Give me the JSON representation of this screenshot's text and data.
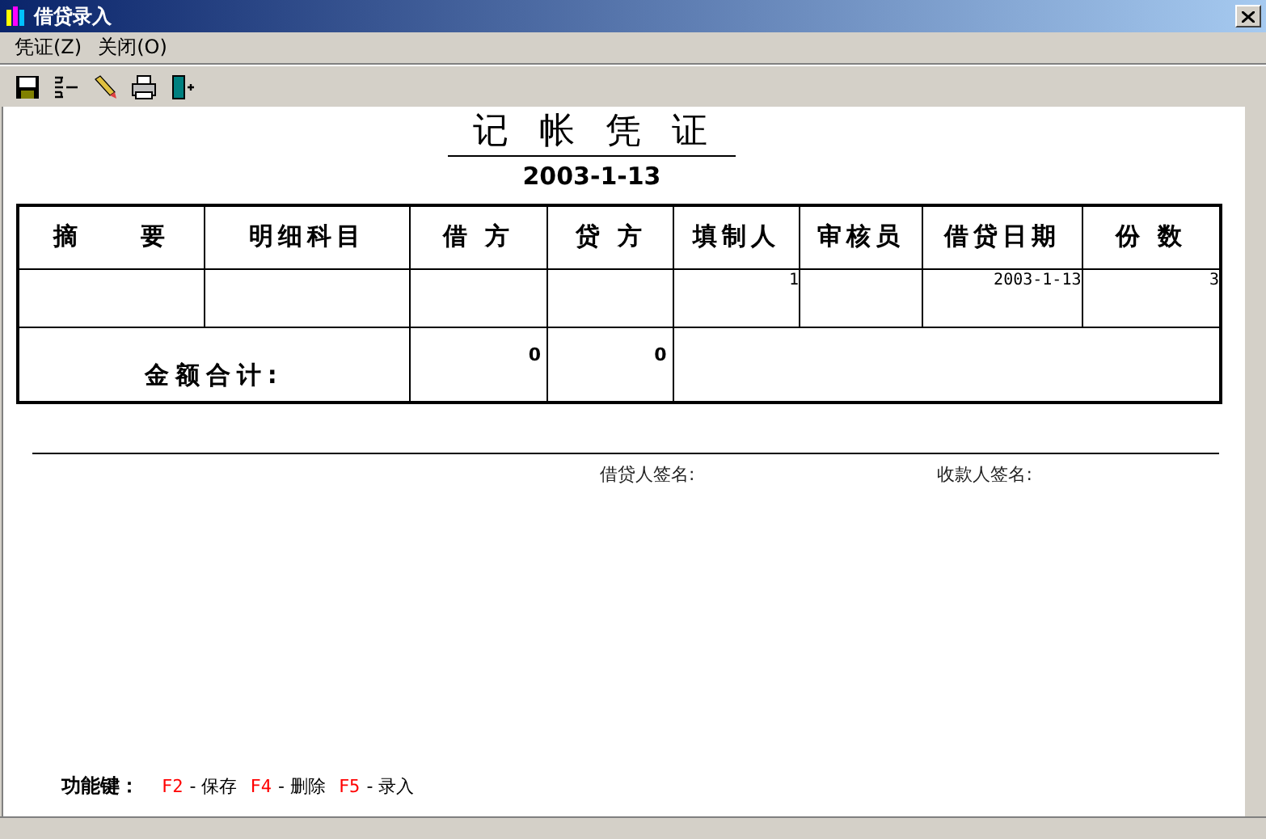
{
  "window": {
    "title": "借贷录入"
  },
  "menu": [
    "凭证(Z)",
    "关闭(O)"
  ],
  "toolbar": [
    {
      "kind": "save"
    },
    {
      "kind": "list"
    },
    {
      "kind": "edit"
    },
    {
      "kind": "print"
    },
    {
      "kind": "exit"
    }
  ],
  "voucher": {
    "title": "记 帐 凭 证",
    "date": "2003-1-13"
  },
  "table": {
    "columns": [
      "摘　　要",
      "明细科目",
      "借 方",
      "贷 方",
      "填制人",
      "审核员",
      "借贷日期",
      "份 数"
    ],
    "rows": [
      [
        "",
        "",
        "",
        "",
        "1",
        "",
        "2003-1-13",
        "3"
      ]
    ],
    "total_label": "金额合计:",
    "total_debit": "0",
    "total_credit": "0"
  },
  "signatures": [
    "借贷人签名:",
    "收款人签名:"
  ],
  "function_keys": {
    "label": "功能键：",
    "items": [
      {
        "key": "F2",
        "action": "- 保存"
      },
      {
        "key": "F4",
        "action": "- 删除"
      },
      {
        "key": "F5",
        "action": "- 录入"
      }
    ]
  }
}
